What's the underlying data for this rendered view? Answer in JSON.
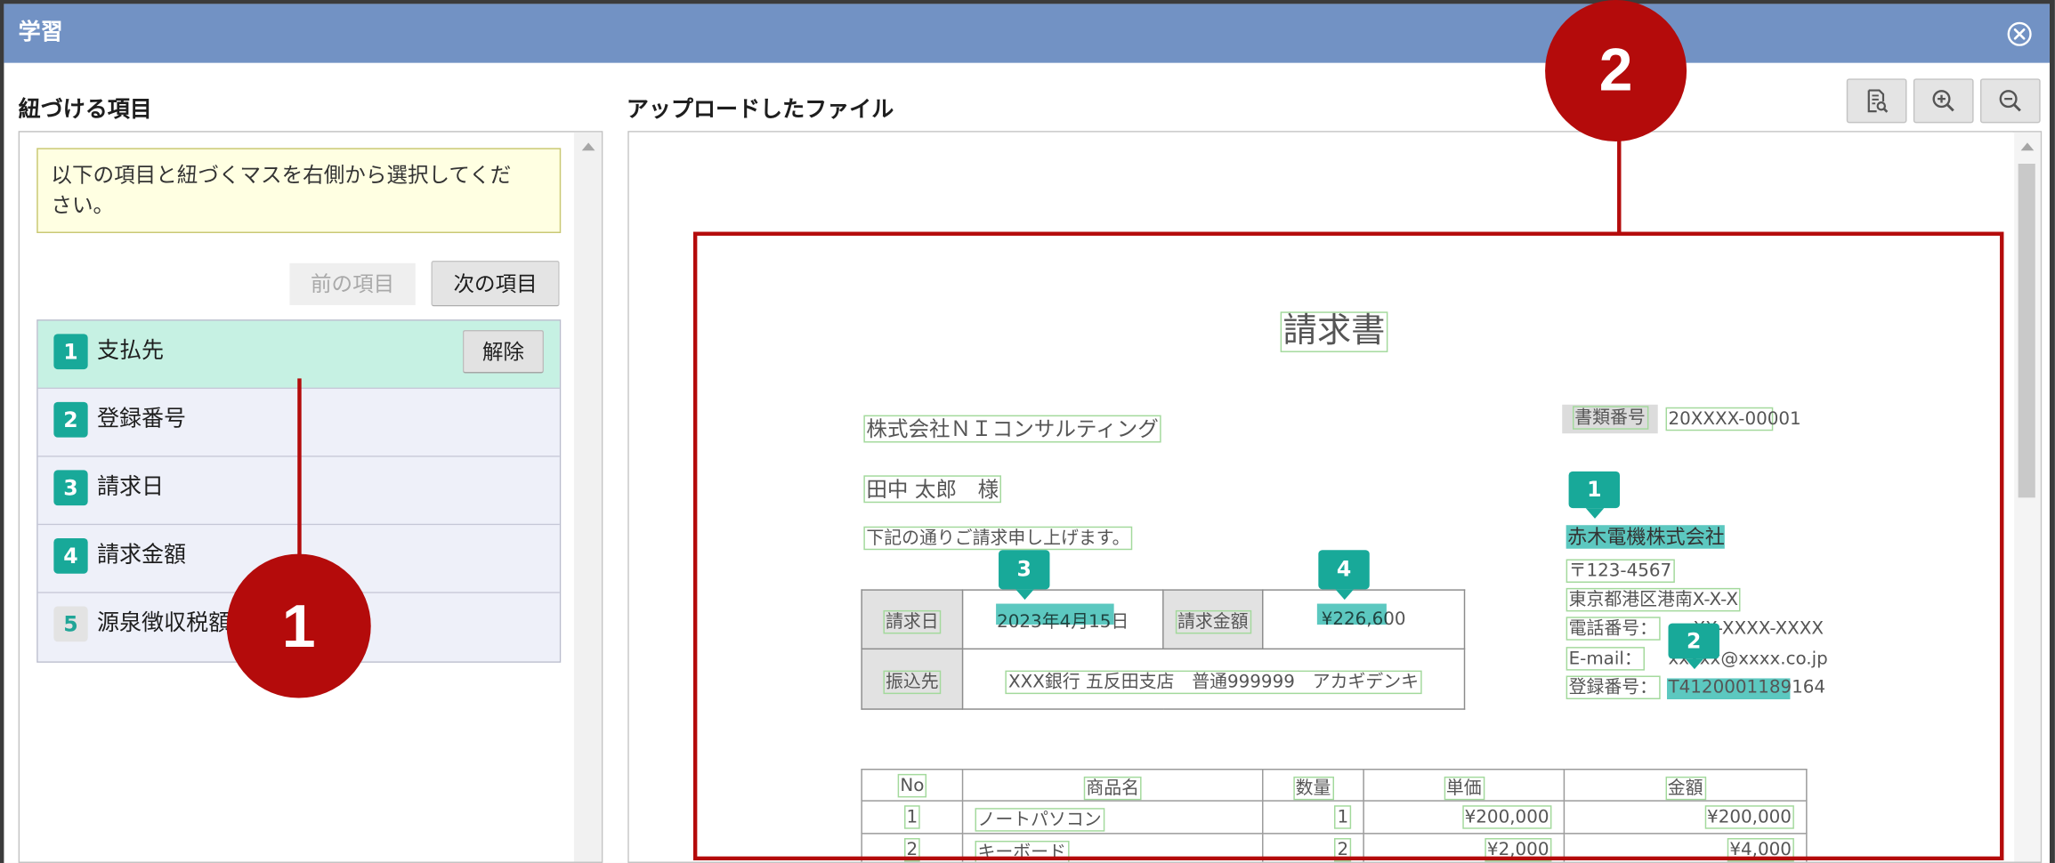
{
  "window": {
    "title": "学習",
    "close_icon": "close-circle-icon"
  },
  "left_panel": {
    "heading": "紐づける項目",
    "instruction": "以下の項目と紐づくマスを右側から選択してください。",
    "prev_button": {
      "label": "前の項目",
      "disabled": true
    },
    "next_button": {
      "label": "次の項目"
    },
    "items": [
      {
        "number": "1",
        "label": "支払先",
        "selected": true,
        "action_label": "解除"
      },
      {
        "number": "2",
        "label": "登録番号"
      },
      {
        "number": "3",
        "label": "請求日"
      },
      {
        "number": "4",
        "label": "請求金額"
      },
      {
        "number": "5",
        "label": "源泉徴収税額"
      }
    ]
  },
  "right_panel": {
    "heading": "アップロードしたファイル",
    "toolbar": [
      {
        "icon": "document-search-icon"
      },
      {
        "icon": "zoom-in-icon"
      },
      {
        "icon": "zoom-out-icon"
      }
    ],
    "document": {
      "title": "請求書",
      "recipient_company": "株式会社ＮＩコンサルティング",
      "recipient_person": "田中 太郎　様",
      "greeting": "下記の通りご請求申し上げます。",
      "doc_number_label": "書類番号",
      "doc_number": "20XXXX-00001",
      "issuer": {
        "company": "赤木電機株式会社",
        "postal": "〒123-4567",
        "address": "東京都港区港南X-X-X",
        "phone_label": "電話番号：",
        "phone": "XX-XXXX-XXXX",
        "email_label": "E-mail：",
        "email": "xxxxx@xxxx.co.jp",
        "registration_label": "登録番号：",
        "registration": "T4120001189164"
      },
      "summary": {
        "date_label": "請求日",
        "date": "2023年4月15日",
        "amount_label": "請求金額",
        "amount": "¥226,600",
        "bank_label": "振込先",
        "bank": "XXX銀行 五反田支店　普通999999　アカギデンキ"
      },
      "items_table": {
        "headers": [
          "No",
          "商品名",
          "数量",
          "単価",
          "金額"
        ],
        "rows": [
          [
            "1",
            "ノートパソコン",
            "1",
            "¥200,000",
            "¥200,000"
          ],
          [
            "2",
            "キーボード",
            "2",
            "¥2,000",
            "¥4,000"
          ]
        ]
      },
      "markers": {
        "payee": "1",
        "registration": "2",
        "date": "3",
        "amount": "4"
      }
    }
  },
  "annotations": [
    {
      "number": "1"
    },
    {
      "number": "2"
    }
  ],
  "colors": {
    "title_bar": "#7292c4",
    "accent_teal": "#18a999",
    "selected_row": "#c6f1e3",
    "list_row": "#eef0f9",
    "annotation_red": "#b40b0b",
    "ocr_box": "#a3d99c",
    "highlight": "#5cc8c0"
  }
}
